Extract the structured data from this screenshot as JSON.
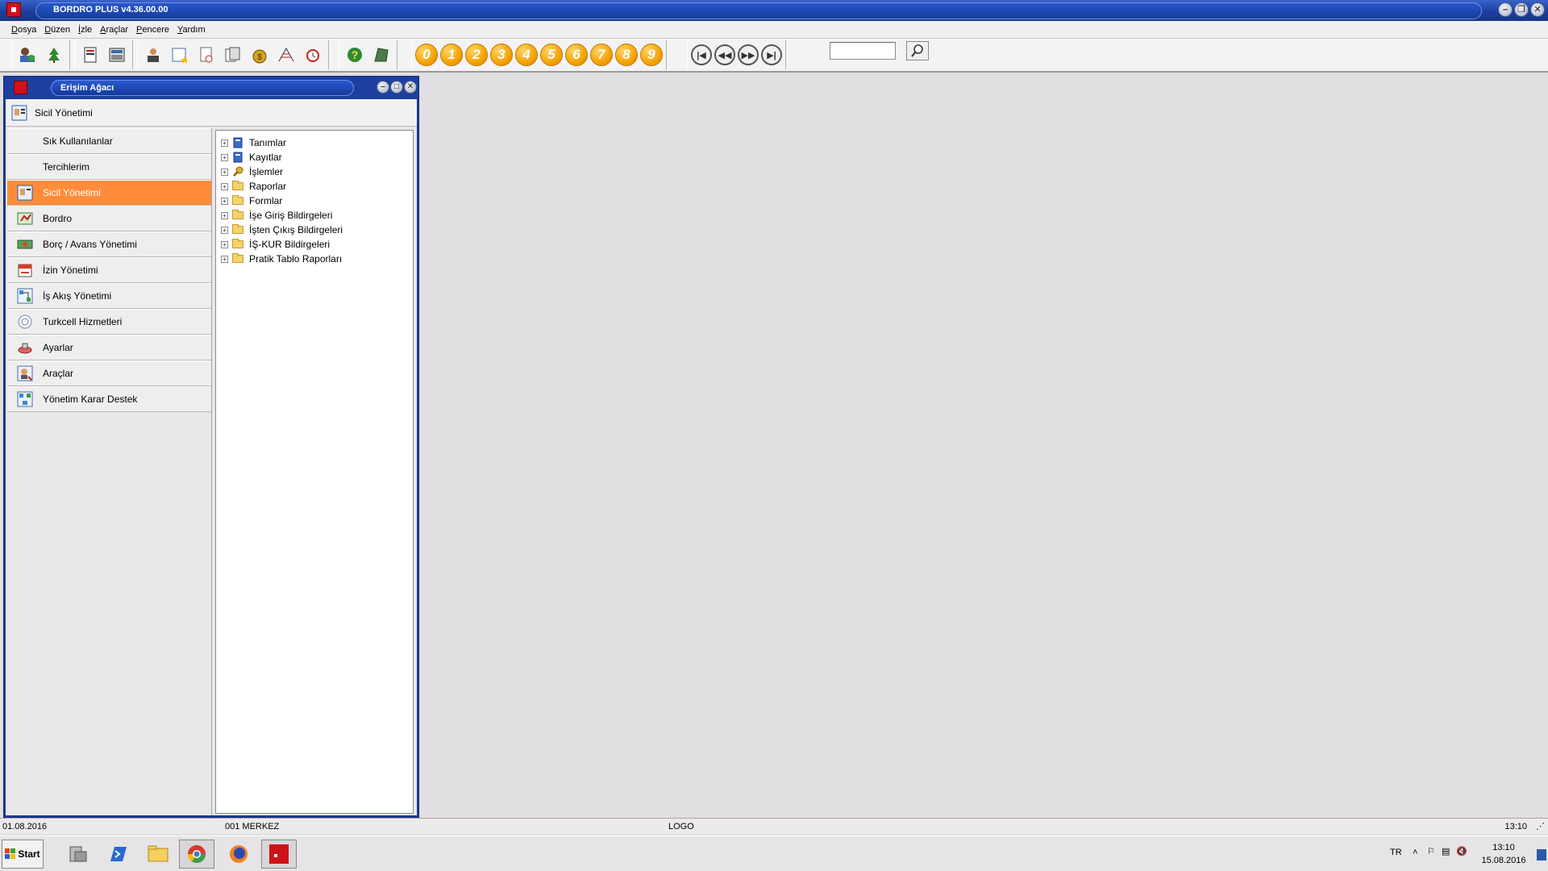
{
  "window": {
    "title": "BORDRO PLUS v4.36.00.00"
  },
  "menu": [
    "Dosya",
    "Düzen",
    "İzle",
    "Araçlar",
    "Pencere",
    "Yardım"
  ],
  "toolbar": {
    "number_buttons": [
      "0",
      "1",
      "2",
      "3",
      "4",
      "5",
      "6",
      "7",
      "8",
      "9"
    ],
    "nav_buttons": [
      "first",
      "previous",
      "next",
      "last"
    ],
    "search_value": ""
  },
  "child_window": {
    "title": "Erişim Ağacı",
    "module_header": "Sicil Yönetimi",
    "sidebar": [
      {
        "label": "Sık Kullanılanlar",
        "icon": "none"
      },
      {
        "label": "Tercihlerim",
        "icon": "none"
      },
      {
        "label": "Sicil Yönetimi",
        "icon": "personnel-card-icon",
        "selected": true
      },
      {
        "label": "Bordro",
        "icon": "payroll-icon"
      },
      {
        "label": "Borç / Avans Yönetimi",
        "icon": "money-icon"
      },
      {
        "label": "İzin Yönetimi",
        "icon": "leave-icon"
      },
      {
        "label": "İş Akış Yönetimi",
        "icon": "workflow-icon"
      },
      {
        "label": "Turkcell Hizmetleri",
        "icon": "service-icon"
      },
      {
        "label": "Ayarlar",
        "icon": "settings-icon"
      },
      {
        "label": "Araçlar",
        "icon": "tools-icon"
      },
      {
        "label": "Yönetim Karar Destek",
        "icon": "decision-support-icon"
      }
    ],
    "tree": [
      {
        "label": "Tanımlar",
        "icon": "book"
      },
      {
        "label": "Kayıtlar",
        "icon": "book"
      },
      {
        "label": "İşlemler",
        "icon": "wrench"
      },
      {
        "label": "Raporlar",
        "icon": "folder"
      },
      {
        "label": "Formlar",
        "icon": "folder"
      },
      {
        "label": "İşe Giriş Bildirgeleri",
        "icon": "folder"
      },
      {
        "label": "İşten Çıkış Bildirgeleri",
        "icon": "folder"
      },
      {
        "label": "İŞ-KUR Bildirgeleri",
        "icon": "folder"
      },
      {
        "label": "Pratik Tablo Raporları",
        "icon": "folder"
      }
    ]
  },
  "statusbar": {
    "date": "01.08.2016",
    "branch": "001 MERKEZ",
    "vendor": "LOGO",
    "time": "13:10"
  },
  "taskbar": {
    "start_label": "Start",
    "language": "TR",
    "clock_time": "13:10",
    "clock_date": "15.08.2016"
  },
  "colors": {
    "title_blue": "#1c3f9e",
    "selected_orange": "#ff8c3a",
    "number_orange": "#f5a300"
  }
}
